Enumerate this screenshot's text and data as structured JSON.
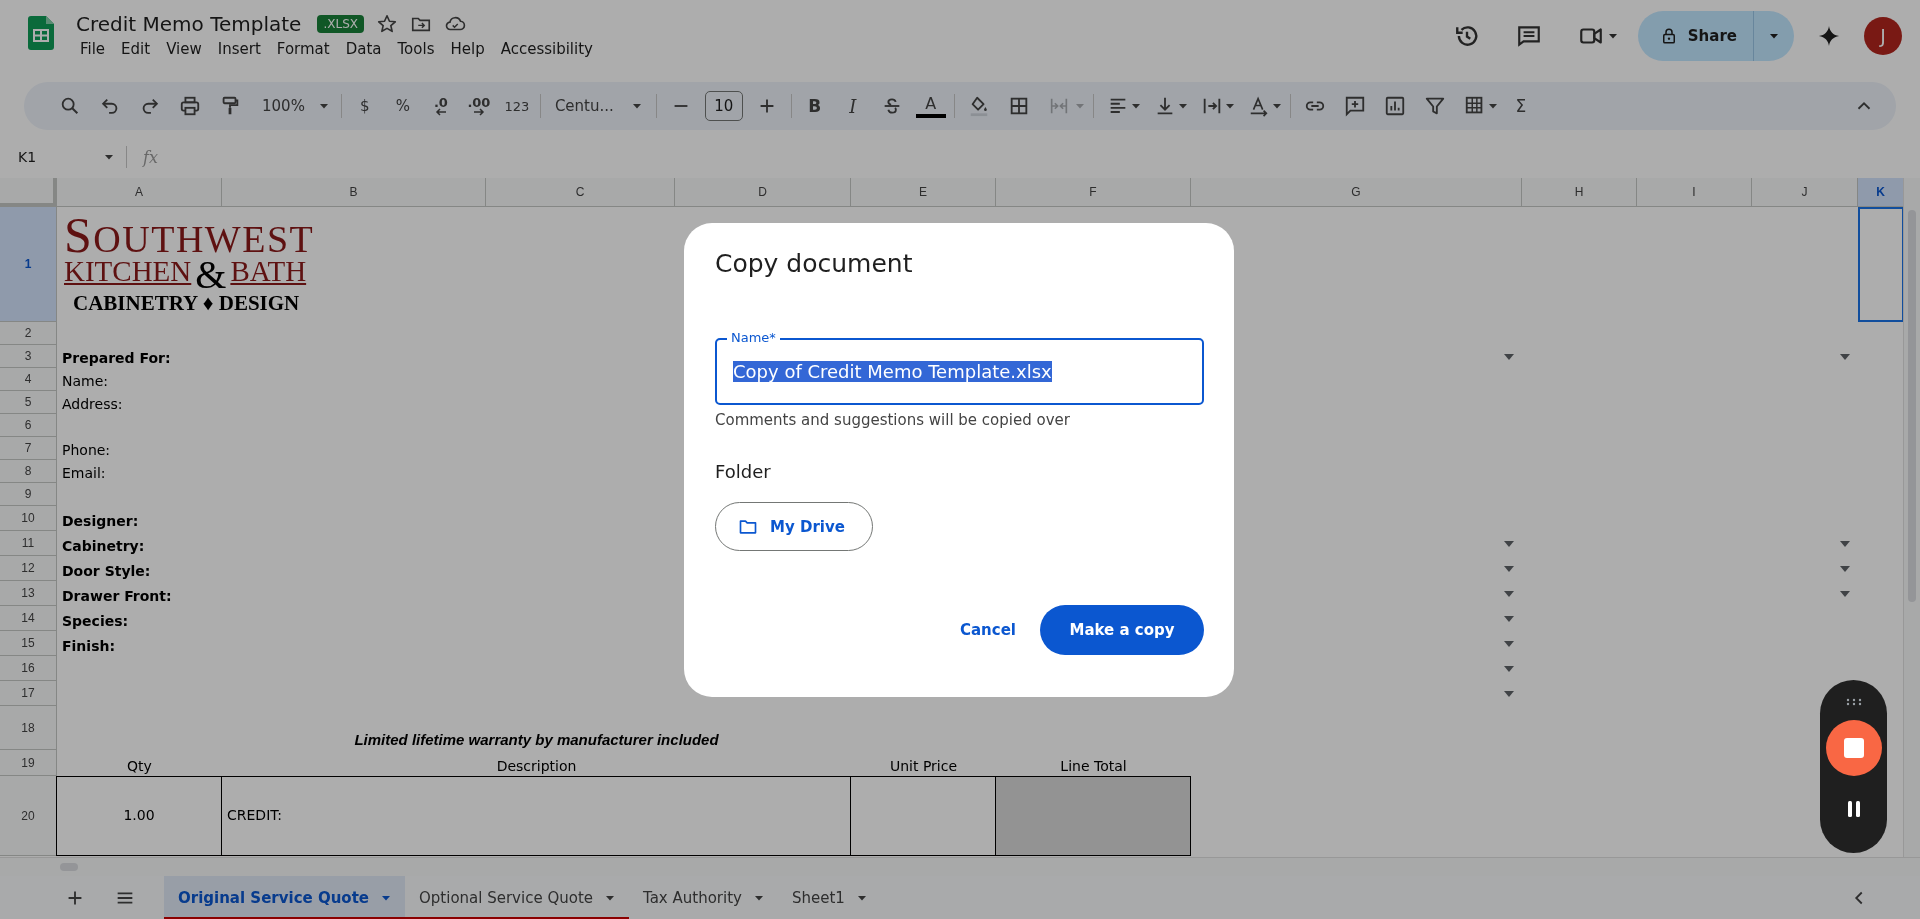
{
  "document": {
    "title": "Credit Memo Template",
    "badge": ".XLSX"
  },
  "menu": [
    "File",
    "Edit",
    "View",
    "Insert",
    "Format",
    "Data",
    "Tools",
    "Help",
    "Accessibility"
  ],
  "share": {
    "label": "Share"
  },
  "account": {
    "initial": "J"
  },
  "toolbar": {
    "zoom": "100%",
    "currency": "$",
    "percent": "%",
    "decrease_decimal": ".0",
    "increase_decimal": ".00",
    "number_format": "123",
    "font": "Centu...",
    "font_size": "10",
    "bold": "B",
    "italic": "I",
    "text_color": "A",
    "functions": "Σ",
    "merge_disabled": true
  },
  "formula_bar": {
    "cell": "K1",
    "label": "fx"
  },
  "sheet": {
    "logo": {
      "top": "SOUTHWEST",
      "left": "KITCHEN",
      "joiner": "&",
      "right": "BATH",
      "tagline": "CABINETRY ♦ DESIGN"
    },
    "columns": [
      {
        "label": "A",
        "selected": false
      },
      {
        "label": "B",
        "selected": false
      },
      {
        "label": "C",
        "selected": false
      },
      {
        "label": "D",
        "selected": false
      },
      {
        "label": "E",
        "selected": false
      },
      {
        "label": "F",
        "selected": false
      },
      {
        "label": "G",
        "selected": false
      },
      {
        "label": "H",
        "selected": false
      },
      {
        "label": "I",
        "selected": false
      },
      {
        "label": "J",
        "selected": false
      },
      {
        "label": "K",
        "selected": true
      }
    ],
    "rows": [
      {
        "label": "1",
        "selected": true,
        "cells": {
          "cell_k": {
            "selected": true
          }
        }
      },
      {
        "label": "2",
        "selected": false,
        "cells": {}
      },
      {
        "label": "3",
        "selected": false,
        "cells": {
          "cell_a": {
            "text": "Prepared For:",
            "kind": "label"
          },
          "cell_g": {
            "dropdown": true
          },
          "cell_j": {
            "dropdown": true
          }
        }
      },
      {
        "label": "4",
        "selected": false,
        "cells": {
          "cell_a": {
            "text": "Name:",
            "kind": "plain"
          }
        }
      },
      {
        "label": "5",
        "selected": false,
        "cells": {
          "cell_a": {
            "text": "Address:",
            "kind": "plain"
          }
        }
      },
      {
        "label": "6",
        "selected": false,
        "cells": {}
      },
      {
        "label": "7",
        "selected": false,
        "cells": {
          "cell_a": {
            "text": "Phone:",
            "kind": "plain"
          }
        }
      },
      {
        "label": "8",
        "selected": false,
        "cells": {
          "cell_a": {
            "text": "Email:",
            "kind": "plain"
          }
        }
      },
      {
        "label": "9",
        "selected": false,
        "cells": {}
      },
      {
        "label": "10",
        "selected": false,
        "cells": {
          "cell_a": {
            "text": "Designer:",
            "kind": "label"
          }
        }
      },
      {
        "label": "11",
        "selected": false,
        "cells": {
          "cell_a": {
            "text": "Cabinetry:",
            "kind": "label"
          },
          "cell_g": {
            "dropdown": true
          },
          "cell_j": {
            "dropdown": true
          }
        }
      },
      {
        "label": "12",
        "selected": false,
        "cells": {
          "cell_a": {
            "text": "Door Style:",
            "kind": "label"
          },
          "cell_g": {
            "dropdown": true
          },
          "cell_j": {
            "dropdown": true
          }
        }
      },
      {
        "label": "13",
        "selected": false,
        "cells": {
          "cell_a": {
            "text": "Drawer Front:",
            "kind": "label"
          },
          "cell_g": {
            "dropdown": true
          },
          "cell_j": {
            "dropdown": true
          }
        }
      },
      {
        "label": "14",
        "selected": false,
        "cells": {
          "cell_a": {
            "text": "Species:",
            "kind": "label"
          },
          "cell_g": {
            "dropdown": true
          }
        }
      },
      {
        "label": "15",
        "selected": false,
        "cells": {
          "cell_a": {
            "text": "Finish:",
            "kind": "label"
          },
          "cell_g": {
            "dropdown": true
          }
        }
      },
      {
        "label": "16",
        "selected": false,
        "cells": {
          "cell_g": {
            "dropdown": true
          }
        }
      },
      {
        "label": "17",
        "selected": false,
        "cells": {
          "cell_g": {
            "dropdown": true
          }
        }
      },
      {
        "label": "18",
        "selected": false,
        "cells": {
          "cell_b": {
            "text": "Limited lifetime warranty by manufacturer included",
            "kind": "note",
            "merged": true
          }
        }
      },
      {
        "label": "19",
        "selected": false,
        "cells": {
          "cell_a": {
            "text": "Qty",
            "kind": "header"
          },
          "cell_b": {
            "text": "Description",
            "kind": "header",
            "merged": true
          },
          "cell_e": {
            "text": "Unit Price",
            "kind": "header"
          },
          "cell_f": {
            "text": "Line Total",
            "kind": "header"
          }
        }
      },
      {
        "label": "20",
        "selected": false,
        "cells": {
          "cell_a": {
            "text": "1.00",
            "kind": "center",
            "bordered": true
          },
          "cell_b": {
            "text": "CREDIT:",
            "kind": "plain",
            "bordered": true,
            "merged": true
          },
          "cell_e": {
            "bordered": true
          },
          "cell_f": {
            "bordered": true,
            "shaded": true
          }
        }
      }
    ]
  },
  "sheet_tabs": [
    {
      "label": "Original Service Quote",
      "selected": true,
      "color": "#8b0000"
    },
    {
      "label": "Optional Service Quote",
      "selected": false,
      "color": "#8b0000"
    },
    {
      "label": "Tax Authority",
      "selected": false
    },
    {
      "label": "Sheet1",
      "selected": false
    }
  ],
  "dialog": {
    "title": "Copy document",
    "name_field": {
      "label": "Name*",
      "value": "Copy of Credit Memo Template.xlsx",
      "text_selected": true
    },
    "helper": "Comments and suggestions will be copied over",
    "folder_label": "Folder",
    "folder_button": "My Drive",
    "cancel": "Cancel",
    "confirm": "Make a copy"
  }
}
